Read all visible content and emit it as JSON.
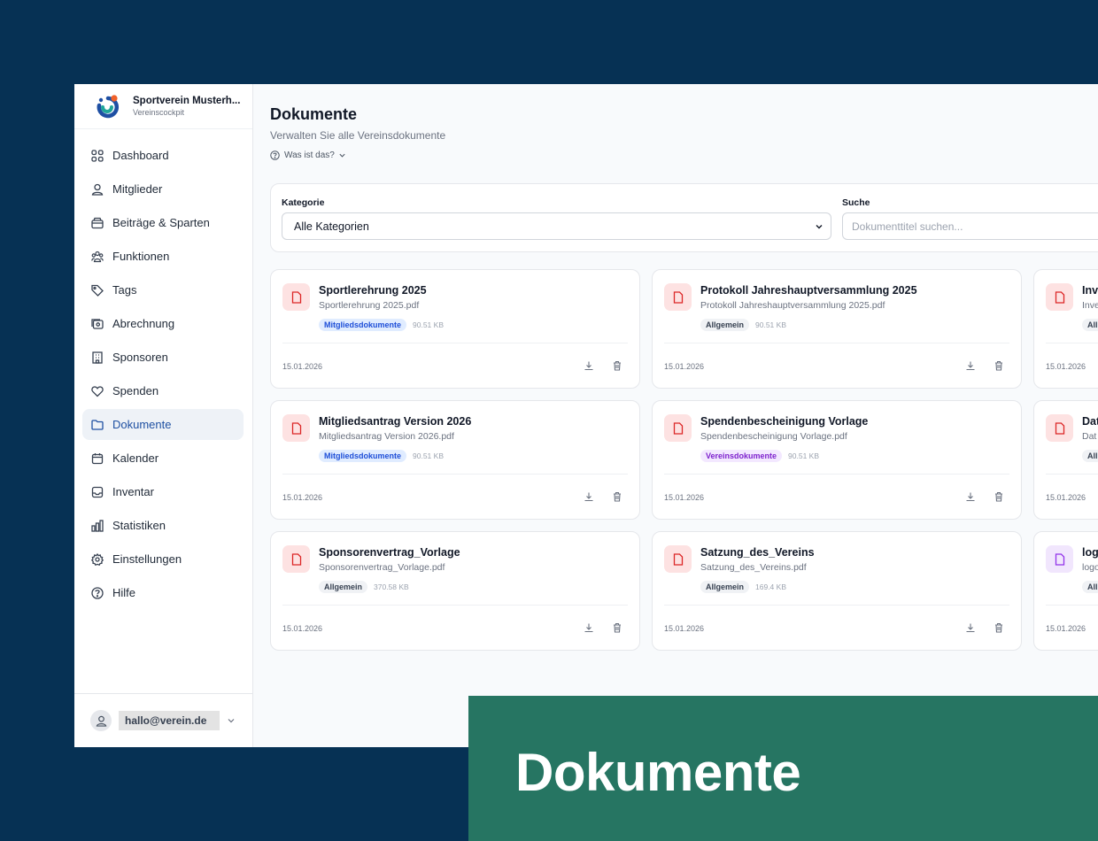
{
  "brand": {
    "name": "Sportverein Musterh...",
    "subtitle": "Vereinscockpit",
    "colors": {
      "orange": "#f0612a",
      "blue": "#1e4fa3",
      "teal": "#1fa59a"
    }
  },
  "nav": [
    {
      "label": "Dashboard",
      "icon": "dashboard-icon"
    },
    {
      "label": "Mitglieder",
      "icon": "users-icon"
    },
    {
      "label": "Beiträge & Sparten",
      "icon": "wallet-icon"
    },
    {
      "label": "Funktionen",
      "icon": "group-icon"
    },
    {
      "label": "Tags",
      "icon": "tag-icon"
    },
    {
      "label": "Abrechnung",
      "icon": "billing-icon"
    },
    {
      "label": "Sponsoren",
      "icon": "building-icon"
    },
    {
      "label": "Spenden",
      "icon": "heart-icon"
    },
    {
      "label": "Dokumente",
      "icon": "folder-icon",
      "active": true
    },
    {
      "label": "Kalender",
      "icon": "calendar-icon"
    },
    {
      "label": "Inventar",
      "icon": "inbox-icon"
    },
    {
      "label": "Statistiken",
      "icon": "chart-icon"
    },
    {
      "label": "Einstellungen",
      "icon": "gear-icon"
    },
    {
      "label": "Hilfe",
      "icon": "help-icon"
    }
  ],
  "user": {
    "email": "hallo@verein.de"
  },
  "page": {
    "title": "Dokumente",
    "subtitle": "Verwalten Sie alle Vereinsdokumente",
    "help": "Was ist das?"
  },
  "filter": {
    "category_label": "Kategorie",
    "category_value": "Alle Kategorien",
    "search_label": "Suche",
    "search_placeholder": "Dokumenttitel suchen..."
  },
  "documents": [
    {
      "title": "Sportlerehrung 2025",
      "file": "Sportlerehrung 2025.pdf",
      "category": "Mitgliedsdokumente",
      "category_color": "blue",
      "size": "90.51 KB",
      "date": "15.01.2026"
    },
    {
      "title": "Protokoll Jahreshauptversammlung 2025",
      "file": "Protokoll Jahreshauptversammlung 2025.pdf",
      "category": "Allgemein",
      "category_color": "gray",
      "size": "90.51 KB",
      "date": "15.01.2026"
    },
    {
      "title": "Inv",
      "file": "Inve",
      "category": "All",
      "category_color": "gray",
      "size": "",
      "date": "15.01.2026"
    },
    {
      "title": "Mitgliedsantrag Version 2026",
      "file": "Mitgliedsantrag Version 2026.pdf",
      "category": "Mitgliedsdokumente",
      "category_color": "blue",
      "size": "90.51 KB",
      "date": "15.01.2026"
    },
    {
      "title": "Spendenbescheinigung Vorlage",
      "file": "Spendenbescheinigung Vorlage.pdf",
      "category": "Vereinsdokumente",
      "category_color": "purple",
      "size": "90.51 KB",
      "date": "15.01.2026"
    },
    {
      "title": "Dat",
      "file": "Dat",
      "category": "All",
      "category_color": "gray",
      "size": "",
      "date": "15.01.2026"
    },
    {
      "title": "Sponsorenvertrag_Vorlage",
      "file": "Sponsorenvertrag_Vorlage.pdf",
      "category": "Allgemein",
      "category_color": "gray",
      "size": "370.58 KB",
      "date": "15.01.2026"
    },
    {
      "title": "Satzung_des_Vereins",
      "file": "Satzung_des_Vereins.pdf",
      "category": "Allgemein",
      "category_color": "gray",
      "size": "169.4 KB",
      "date": "15.01.2026"
    },
    {
      "title": "log",
      "file": "logo",
      "category": "All",
      "category_color": "gray",
      "size": "",
      "date": "15.01.2026",
      "icon_color": "purple"
    }
  ],
  "overlay": {
    "title": "Dokumente"
  }
}
